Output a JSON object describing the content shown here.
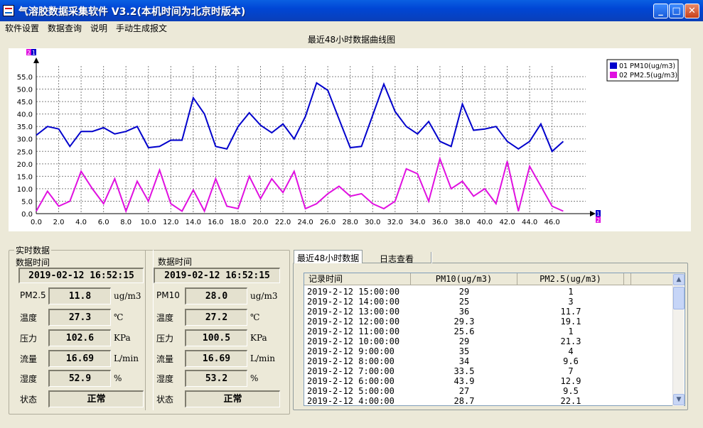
{
  "window": {
    "title": "气溶胶数据采集软件 V3.2(本机时间为北京时版本)",
    "buttons": {
      "minimize": "_",
      "maximize": "□",
      "close": "✕"
    }
  },
  "menu": [
    "软件设置",
    "数据查询",
    "说明",
    "手动生成报文"
  ],
  "chart_title": "最近48小时数据曲线图",
  "chart_data": {
    "type": "line",
    "x": [
      0,
      1,
      2,
      3,
      4,
      5,
      6,
      7,
      8,
      9,
      10,
      11,
      12,
      13,
      14,
      15,
      16,
      17,
      18,
      19,
      20,
      21,
      22,
      23,
      24,
      25,
      26,
      27,
      28,
      29,
      30,
      31,
      32,
      33,
      34,
      35,
      36,
      37,
      38,
      39,
      40,
      41,
      42,
      43,
      44,
      45,
      46,
      47
    ],
    "series": [
      {
        "name": "01 PM10(ug/m3)",
        "color": "#0000cc",
        "values": [
          31.5,
          35,
          34,
          27,
          33,
          33,
          34.5,
          32,
          33,
          35,
          26.5,
          27,
          29.5,
          29.5,
          46.5,
          40,
          27,
          26,
          35,
          40.5,
          35.5,
          32.5,
          36,
          30,
          39,
          52.5,
          49.5,
          38,
          26.5,
          27,
          39.5,
          52,
          41,
          35,
          32,
          37,
          29,
          27,
          44,
          33.5,
          34,
          35,
          29,
          26,
          29,
          36,
          25,
          29
        ]
      },
      {
        "name": "02 PM2.5(ug/m3)",
        "color": "#e010e0",
        "values": [
          1,
          9,
          3,
          5,
          17,
          10,
          4,
          14,
          1,
          13,
          5,
          17.5,
          4,
          1,
          9.5,
          1,
          14,
          3,
          2,
          15,
          6,
          14,
          8.5,
          17,
          2,
          4,
          8,
          11,
          7,
          8,
          4,
          2,
          5,
          18,
          16,
          5,
          22,
          10,
          13,
          7,
          10,
          4,
          21,
          1,
          19,
          11,
          3,
          1
        ]
      }
    ],
    "y_ticks": [
      "0.0",
      "5.0",
      "10.0",
      "15.0",
      "20.0",
      "25.0",
      "30.0",
      "35.0",
      "40.0",
      "45.0",
      "50.0",
      "55.0"
    ],
    "x_ticks": [
      "0.0",
      "2.0",
      "4.0",
      "6.0",
      "8.0",
      "10.0",
      "12.0",
      "14.0",
      "16.0",
      "18.0",
      "20.0",
      "22.0",
      "24.0",
      "26.0",
      "28.0",
      "30.0",
      "32.0",
      "34.0",
      "36.0",
      "38.0",
      "40.0",
      "42.0",
      "44.0",
      "46.0"
    ],
    "ylim": [
      0,
      57
    ],
    "xlim": [
      0,
      49
    ],
    "axis_markers": {
      "top_left": [
        "2",
        "1"
      ],
      "bottom_right": [
        "1",
        "2"
      ]
    },
    "grid": true,
    "legend_position": "top-right"
  },
  "realtime": {
    "group_label": "实时数据",
    "left": {
      "time_label": "数据时间",
      "time": "2019-02-12 16:52:15",
      "fields": [
        {
          "label": "PM2.5",
          "value": "11.8",
          "unit": "ug/m3"
        },
        {
          "label": "温度",
          "value": "27.3",
          "unit": "℃"
        },
        {
          "label": "压力",
          "value": "102.6",
          "unit": "KPa"
        },
        {
          "label": "流量",
          "value": "16.69",
          "unit": "L/min"
        },
        {
          "label": "湿度",
          "value": "52.9",
          "unit": "%"
        },
        {
          "label": "状态",
          "value": "正常",
          "unit": ""
        }
      ]
    },
    "right": {
      "time_label": "数据时间",
      "time": "2019-02-12 16:52:15",
      "fields": [
        {
          "label": "PM10",
          "value": "28.0",
          "unit": "ug/m3"
        },
        {
          "label": "温度",
          "value": "27.2",
          "unit": "℃"
        },
        {
          "label": "压力",
          "value": "100.5",
          "unit": "KPa"
        },
        {
          "label": "流量",
          "value": "16.69",
          "unit": "L/min"
        },
        {
          "label": "湿度",
          "value": "53.2",
          "unit": "%"
        },
        {
          "label": "状态",
          "value": "正常",
          "unit": ""
        }
      ]
    }
  },
  "tabs": [
    "最近48小时数据",
    "日志查看"
  ],
  "table": {
    "columns": [
      "记录时间",
      "PM10(ug/m3)",
      "PM2.5(ug/m3)"
    ],
    "rows": [
      [
        "2019-2-12 15:00:00",
        "29",
        "1"
      ],
      [
        "2019-2-12 14:00:00",
        "25",
        "3"
      ],
      [
        "2019-2-12 13:00:00",
        "36",
        "11.7"
      ],
      [
        "2019-2-12 12:00:00",
        "29.3",
        "19.1"
      ],
      [
        "2019-2-12 11:00:00",
        "25.6",
        "1"
      ],
      [
        "2019-2-12 10:00:00",
        "29",
        "21.3"
      ],
      [
        "2019-2-12 9:00:00",
        "35",
        "4"
      ],
      [
        "2019-2-12 8:00:00",
        "34",
        "9.6"
      ],
      [
        "2019-2-12 7:00:00",
        "33.5",
        "7"
      ],
      [
        "2019-2-12 6:00:00",
        "43.9",
        "12.9"
      ],
      [
        "2019-2-12 5:00:00",
        "27",
        "9.5"
      ],
      [
        "2019-2-12 4:00:00",
        "28.7",
        "22.1"
      ]
    ]
  }
}
